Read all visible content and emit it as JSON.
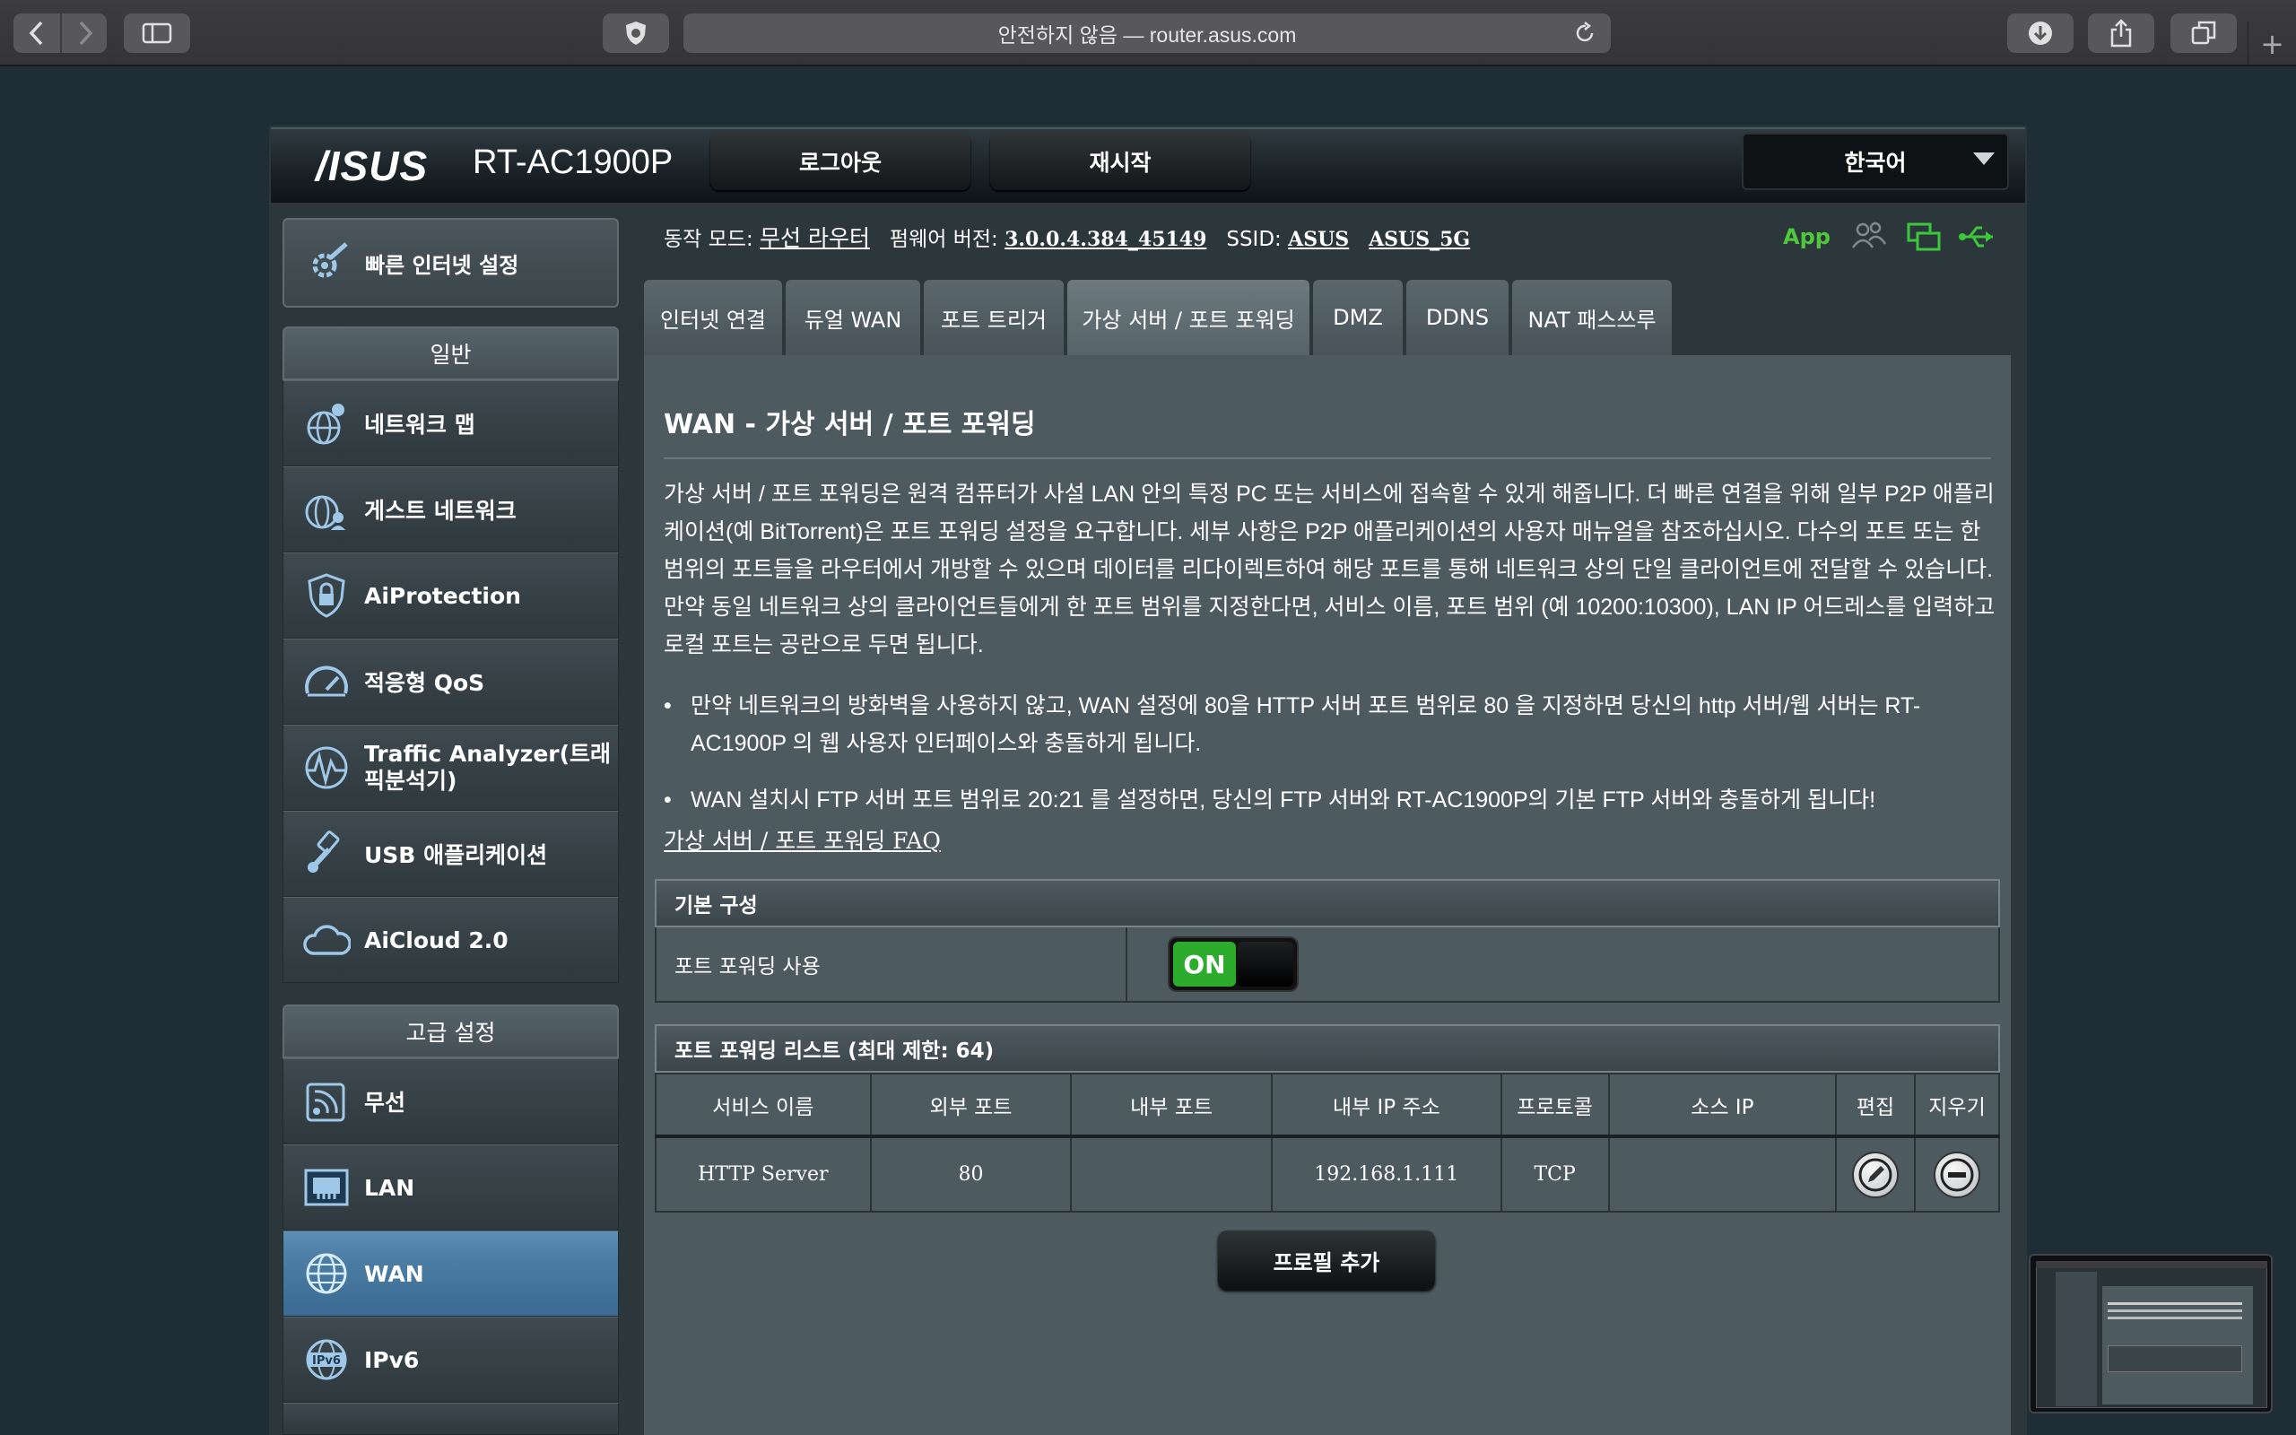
{
  "browser": {
    "url_text": "안전하지 않음 — router.asus.com",
    "icons": {
      "back": "chevron-left-icon",
      "forward": "chevron-right-icon",
      "sidebar": "sidebar-icon",
      "shield": "ublock-shield-icon",
      "reload": "reload-icon",
      "download": "download-icon",
      "share": "share-icon",
      "tabs": "tabs-icon",
      "new_tab": "plus-icon"
    }
  },
  "header": {
    "brand": "/ISUS",
    "model": "RT-AC1900P",
    "logout_label": "로그아웃",
    "reboot_label": "재시작",
    "language": "한국어"
  },
  "status": {
    "mode_label": "동작 모드:",
    "mode_value": "무선 라우터",
    "firmware_label": "펌웨어 버전:",
    "firmware_value": "3.0.0.4.384_45149",
    "ssid_label": "SSID:",
    "ssid_1": "ASUS",
    "ssid_2": "ASUS_5G",
    "app_label": "App"
  },
  "sidebar": {
    "quick_setup": "빠른 인터넷 설정",
    "general_header": "일반",
    "general_items": [
      {
        "label": "네트워크 맵",
        "icon": "network-map-icon"
      },
      {
        "label": "게스트 네트워크",
        "icon": "guest-network-icon"
      },
      {
        "label": "AiProtection",
        "icon": "shield-lock-icon"
      },
      {
        "label": "적응형 QoS",
        "icon": "speedometer-icon"
      },
      {
        "label": "Traffic Analyzer(트래픽분석기)",
        "icon": "traffic-wave-icon"
      },
      {
        "label": "USB 애플리케이션",
        "icon": "usb-icon"
      },
      {
        "label": "AiCloud 2.0",
        "icon": "cloud-icon"
      }
    ],
    "advanced_header": "고급 설정",
    "advanced_items": [
      {
        "label": "무선",
        "icon": "wireless-icon"
      },
      {
        "label": "LAN",
        "icon": "lan-icon"
      },
      {
        "label": "WAN",
        "icon": "globe-icon",
        "active": true
      },
      {
        "label": "IPv6",
        "icon": "ipv6-icon"
      }
    ]
  },
  "tabs": [
    "인터넷 연결",
    "듀얼 WAN",
    "포트 트리거",
    "가상 서버 / 포트 포워딩",
    "DMZ",
    "DDNS",
    "NAT 패스쓰루"
  ],
  "active_tab": "가상 서버 / 포트 포워딩",
  "content": {
    "title": "WAN - 가상 서버 / 포트 포워딩",
    "desc_1": "가상 서버 / 포트 포워딩은 원격 컴퓨터가 사설 LAN 안의 특정 PC 또는 서비스에 접속할 수 있게 해줍니다. 더 빠른 연결을 위해 일부 P2P 애플리케이션(예 BitTorrent)은 포트 포워딩 설정을 요구합니다. 세부 사항은 P2P 애플리케이션의 사용자 매뉴얼을 참조하십시오. 다수의 포트 또는 한 범위의 포트들을 라우터에서 개방할 수 있으며 데이터를 리다이렉트하여 해당 포트를 통해 네트워크 상의 단일 클라이언트에 전달할 수 있습니다.",
    "desc_2": "만약 동일 네트워크 상의 클라이언트들에게 한 포트 범위를 지정한다면, 서비스 이름, 포트 범위 (예 10200:10300), LAN IP 어드레스를 입력하고 로컬 포트는 공란으로 두면 됩니다.",
    "bullet_1": "만약 네트워크의 방화벽을 사용하지 않고, WAN 설정에 80을 HTTP 서버 포트 범위로 80 을 지정하면 당신의 http 서버/웹 서버는 RT-AC1900P 의 웹 사용자 인터페이스와 충돌하게 됩니다.",
    "bullet_2": "WAN 설치시 FTP 서버 포트 범위로 20:21 를 설정하면, 당신의 FTP 서버와 RT-AC1900P의 기본 FTP 서버와 충돌하게 됩니다!",
    "faq_link": "가상 서버 / 포트 포워딩 FAQ"
  },
  "basic_config": {
    "header": "기본 구성",
    "enable_label": "포트 포워딩 사용",
    "toggle_value": "ON"
  },
  "pf_list": {
    "header": "포트 포워딩 리스트 (최대 제한: 64)",
    "columns": [
      "서비스 이름",
      "외부 포트",
      "내부 포트",
      "내부 IP 주소",
      "프로토콜",
      "소스 IP",
      "편집",
      "지우기"
    ],
    "rows": [
      {
        "service": "HTTP Server",
        "external_port": "80",
        "internal_port": "",
        "internal_ip": "192.168.1.111",
        "protocol": "TCP",
        "source_ip": ""
      }
    ],
    "add_profile_label": "프로필 추가"
  }
}
